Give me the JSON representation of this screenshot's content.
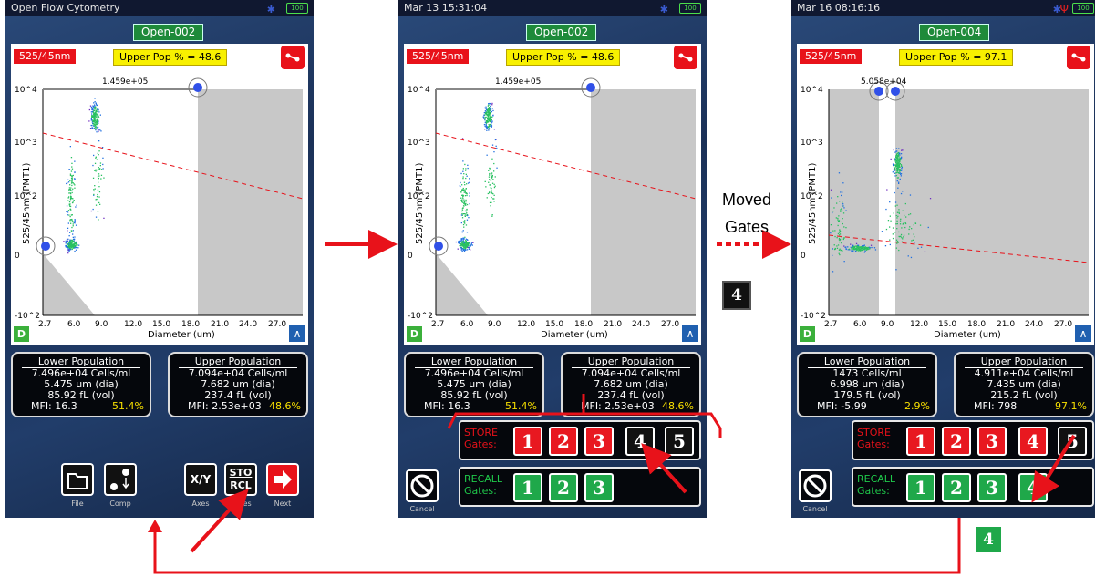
{
  "colors": {
    "accent_red": "#e8121a",
    "gate_green": "#1fa84a",
    "arrow_red": "#e8121a"
  },
  "screens": [
    {
      "status": "Open Flow Cytometry",
      "file_title": "Open-002",
      "channel": "525/45nm",
      "upper_pop": "Upper Pop % = 48.6",
      "gate_value": "1.459e+05",
      "lower": {
        "header": "Lower Population",
        "cells": "7.496e+04 Cells/ml",
        "dia": "5.475 um (dia)",
        "vol": "85.92 fL (vol)",
        "mfi": "MFI: 16.3",
        "pct": "51.4%"
      },
      "upper": {
        "header": "Upper Population",
        "cells": "7.094e+04 Cells/ml",
        "dia": "7.682 um (dia)",
        "vol": "237.4 fL (vol)",
        "mfi": "MFI: 2.53e+03",
        "pct": "48.6%"
      },
      "toolbar": {
        "file": "File",
        "comp": "Comp",
        "axes": "Axes",
        "axes_icon": "X/Y",
        "gates": "Gates",
        "sto": "STO",
        "rcl": "RCL",
        "next": "Next"
      }
    },
    {
      "status": "Mar 13 15:31:04",
      "file_title": "Open-002",
      "channel": "525/45nm",
      "upper_pop": "Upper Pop % = 48.6",
      "gate_value": "1.459e+05",
      "lower": {
        "header": "Lower Population",
        "cells": "7.496e+04 Cells/ml",
        "dia": "5.475 um (dia)",
        "vol": "85.92 fL (vol)",
        "mfi": "MFI: 16.3",
        "pct": "51.4%"
      },
      "upper": {
        "header": "Upper Population",
        "cells": "7.094e+04 Cells/ml",
        "dia": "7.682 um (dia)",
        "vol": "237.4 fL (vol)",
        "mfi": "MFI: 2.53e+03",
        "pct": "48.6%"
      },
      "store_label": "STORE Gates:",
      "recall_label": "RECALL Gates:",
      "store_buttons": [
        "1",
        "2",
        "3",
        "4",
        "5"
      ],
      "recall_buttons": [
        "1",
        "2",
        "3"
      ],
      "cancel": "Cancel"
    },
    {
      "status": "Mar 16 08:16:16",
      "file_title": "Open-004",
      "channel": "525/45nm",
      "upper_pop": "Upper Pop % = 97.1",
      "gate_value": "5.058e+04",
      "lower": {
        "header": "Lower Population",
        "cells": "1473 Cells/ml",
        "dia": "6.998 um (dia)",
        "vol": "179.5 fL (vol)",
        "mfi": "MFI: -5.99",
        "pct": "2.9%"
      },
      "upper": {
        "header": "Upper Population",
        "cells": "4.911e+04 Cells/ml",
        "dia": "7.435 um (dia)",
        "vol": "215.2 fL (vol)",
        "mfi": "MFI: 798",
        "pct": "97.1%"
      },
      "store_label": "STORE Gates:",
      "recall_label": "RECALL Gates:",
      "store_buttons": [
        "1",
        "2",
        "3",
        "4",
        "5"
      ],
      "recall_buttons": [
        "1",
        "2",
        "3",
        "4"
      ],
      "cancel": "Cancel"
    }
  ],
  "plot": {
    "xlabel": "Diameter (um)",
    "ylabel": "525/45nm (PMT1)",
    "x_ticks": [
      "2.7",
      "6.0",
      "9.0",
      "12.0",
      "15.0",
      "18.0",
      "21.0",
      "24.0",
      "27.0"
    ],
    "y_ticks": [
      "10^4",
      "10^3",
      "10^2",
      "0",
      "-10^2"
    ]
  },
  "annotations": {
    "moved_gates": "Moved Gates",
    "badge_4_mid": "4",
    "badge_4_bottom": "4"
  },
  "battery": "100"
}
